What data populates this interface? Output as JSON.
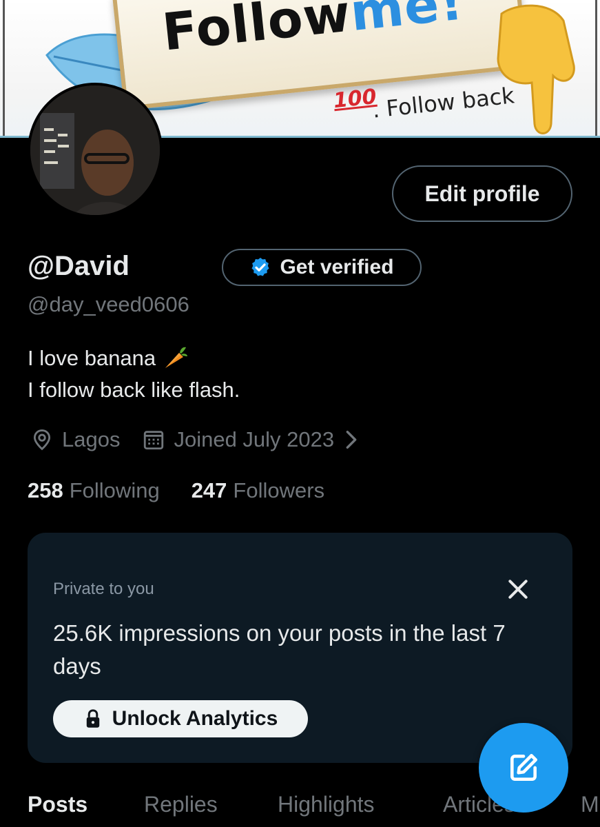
{
  "banner": {
    "title_dark": "Follow",
    "title_blue": "me!",
    "hundred": "100",
    "follow_back": ". Follow back"
  },
  "profile": {
    "display_name": "@David",
    "handle": "@day_veed0606",
    "edit_label": "Edit profile",
    "verify_label": "Get verified",
    "bio_line1": "I love banana",
    "bio_line2": "I follow back like flash.",
    "location": "Lagos",
    "joined": "Joined July 2023",
    "following_count": "258",
    "following_label": "Following",
    "followers_count": "247",
    "followers_label": "Followers"
  },
  "analytics": {
    "private_label": "Private to you",
    "impressions_text": "25.6K impressions on your posts in the last 7 days",
    "unlock_label": "Unlock Analytics"
  },
  "tabs": [
    {
      "label": "Posts",
      "active": true
    },
    {
      "label": "Replies",
      "active": false
    },
    {
      "label": "Highlights",
      "active": false
    },
    {
      "label": "Articles",
      "active": false
    },
    {
      "label": "M",
      "active": false
    }
  ],
  "colors": {
    "background": "#000000",
    "accent": "#1d9bf0",
    "muted_text": "#71767b",
    "card_bg": "#0d1a24"
  },
  "icons": {
    "verified": "verified-badge-icon",
    "location": "location-pin-icon",
    "calendar": "calendar-icon",
    "chevron": "chevron-right-icon",
    "close": "close-icon",
    "lock": "lock-icon",
    "compose": "compose-icon",
    "emoji_bio": "carrot-emoji-icon"
  }
}
